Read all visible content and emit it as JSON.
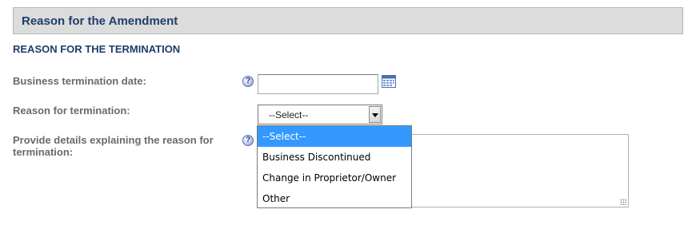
{
  "section": {
    "title": "Reason for the Amendment"
  },
  "subheading": "REASON FOR THE TERMINATION",
  "fields": {
    "termination_date": {
      "label": "Business termination date:",
      "value": ""
    },
    "reason": {
      "label": "Reason for termination:",
      "selected": "--Select--"
    },
    "details": {
      "label_line1": "Provide details explaining the reason for",
      "label_line2": "termination:",
      "value": ""
    }
  },
  "dropdown": {
    "options": [
      "--Select--",
      "Business Discontinued",
      "Change in Proprietor/Owner",
      "Other"
    ],
    "highlighted_index": 0
  },
  "icons": {
    "help": "help-icon",
    "calendar": "calendar-icon",
    "dropdown_arrow": "chevron-down-icon"
  },
  "colors": {
    "heading": "#1f3d6b",
    "label": "#6a6a6a",
    "highlight": "#3399ff"
  }
}
